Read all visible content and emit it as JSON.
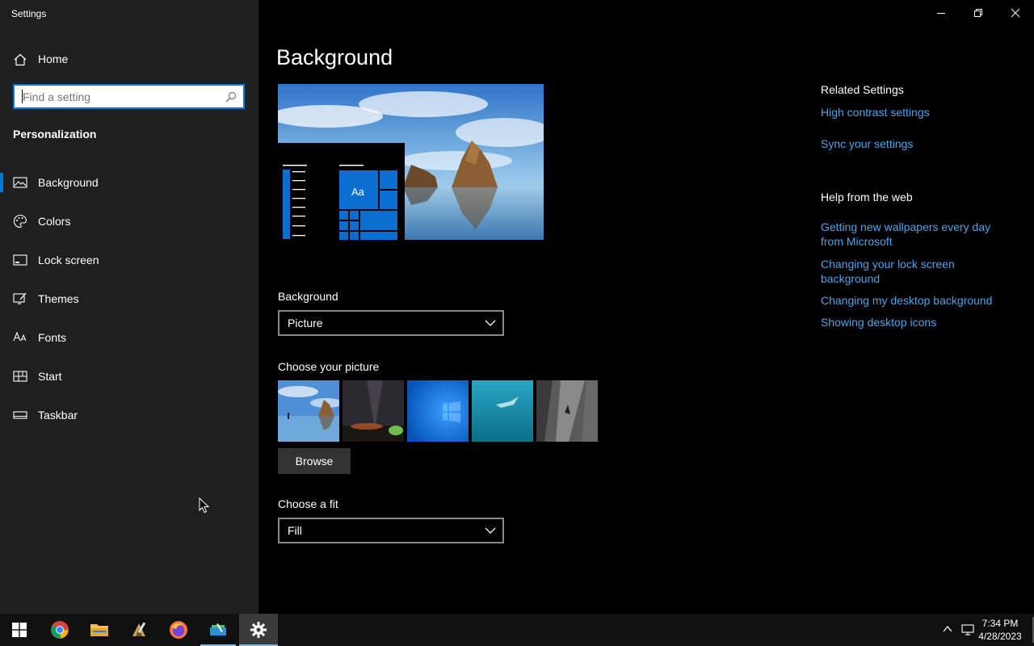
{
  "window": {
    "title": "Settings"
  },
  "sidebar": {
    "home_label": "Home",
    "search_placeholder": "Find a setting",
    "section_title": "Personalization",
    "items": [
      {
        "label": "Background",
        "icon": "picture-icon",
        "active": true
      },
      {
        "label": "Colors",
        "icon": "palette-icon",
        "active": false
      },
      {
        "label": "Lock screen",
        "icon": "lock-screen-icon",
        "active": false
      },
      {
        "label": "Themes",
        "icon": "themes-icon",
        "active": false
      },
      {
        "label": "Fonts",
        "icon": "fonts-icon",
        "active": false
      },
      {
        "label": "Start",
        "icon": "start-icon",
        "active": false
      },
      {
        "label": "Taskbar",
        "icon": "taskbar-icon",
        "active": false
      }
    ]
  },
  "main": {
    "title": "Background",
    "preview": {
      "sample_text": "Aa"
    },
    "background_label": "Background",
    "background_value": "Picture",
    "choose_picture_label": "Choose your picture",
    "browse_label": "Browse",
    "fit_label": "Choose a fit",
    "fit_value": "Fill"
  },
  "related": {
    "heading": "Related Settings",
    "links": [
      "High contrast settings",
      "Sync your settings"
    ],
    "help_heading": "Help from the web",
    "help_links": [
      "Getting new wallpapers every day from Microsoft",
      "Changing your lock screen background",
      "Changing my desktop background",
      "Showing desktop icons"
    ]
  },
  "taskbar": {
    "time": "7:34 PM",
    "date": "4/28/2023",
    "apps": [
      "windows-start-icon",
      "chrome-icon",
      "file-explorer-icon",
      "app-icon",
      "firefox-icon",
      "app-icon-2",
      "settings-gear-icon"
    ]
  },
  "colors": {
    "accent": "#0078d7",
    "link": "#4ca3e8",
    "sidebar": "#1f1f1f",
    "taskbar": "#101010"
  }
}
